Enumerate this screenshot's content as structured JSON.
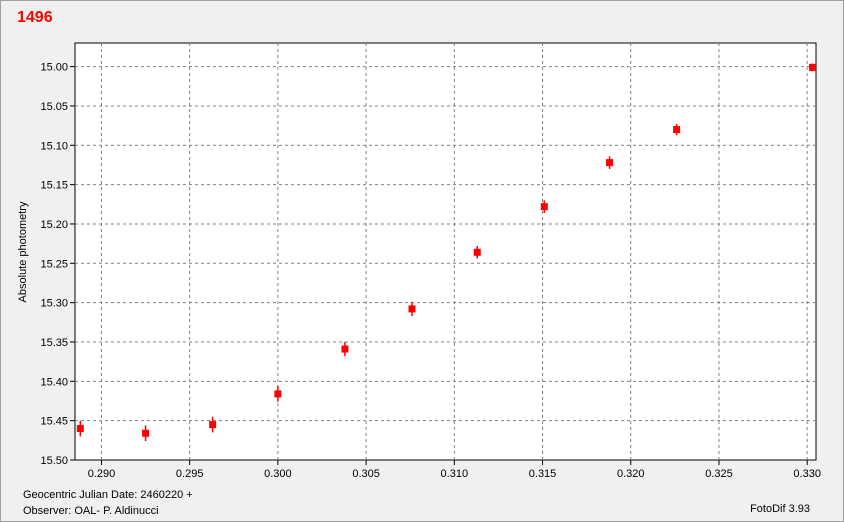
{
  "window": {
    "title": "1496",
    "footer": {
      "jd_label": "Geocentric Julian Date: 2460220 +",
      "observer": "Observer: OAL- P. Aldinucci",
      "software": "FotoDif 3.93"
    }
  },
  "chart_data": {
    "type": "scatter",
    "title": "1496",
    "xlabel": "",
    "ylabel": "Absolute photometry",
    "xlim": [
      0.2885,
      0.3305
    ],
    "ylim": [
      15.5,
      14.97
    ],
    "y_inverted": true,
    "grid": true,
    "xticks": [
      0.29,
      0.295,
      0.3,
      0.305,
      0.31,
      0.315,
      0.32,
      0.325,
      0.33
    ],
    "xtick_labels": [
      "0.290",
      "0.295",
      "0.300",
      "0.305",
      "0.310",
      "0.315",
      "0.320",
      "0.325",
      "0.330"
    ],
    "yticks": [
      15.0,
      15.05,
      15.1,
      15.15,
      15.2,
      15.25,
      15.3,
      15.35,
      15.4,
      15.45,
      15.5
    ],
    "ytick_labels": [
      "15.00",
      "15.05",
      "15.10",
      "15.15",
      "15.20",
      "15.25",
      "15.30",
      "15.35",
      "15.40",
      "15.45",
      "15.50"
    ],
    "color": "#ff0000",
    "points": [
      {
        "x": 0.2888,
        "y": 15.46,
        "err": 0.01
      },
      {
        "x": 0.2925,
        "y": 15.466,
        "err": 0.01
      },
      {
        "x": 0.2963,
        "y": 15.455,
        "err": 0.01
      },
      {
        "x": 0.3,
        "y": 15.416,
        "err": 0.01
      },
      {
        "x": 0.3038,
        "y": 15.359,
        "err": 0.009
      },
      {
        "x": 0.3076,
        "y": 15.308,
        "err": 0.009
      },
      {
        "x": 0.3113,
        "y": 15.236,
        "err": 0.008
      },
      {
        "x": 0.3151,
        "y": 15.178,
        "err": 0.008
      },
      {
        "x": 0.3188,
        "y": 15.122,
        "err": 0.008
      },
      {
        "x": 0.3226,
        "y": 15.08,
        "err": 0.007
      },
      {
        "x": 0.3303,
        "y": 15.001,
        "err": 0.005
      }
    ]
  }
}
